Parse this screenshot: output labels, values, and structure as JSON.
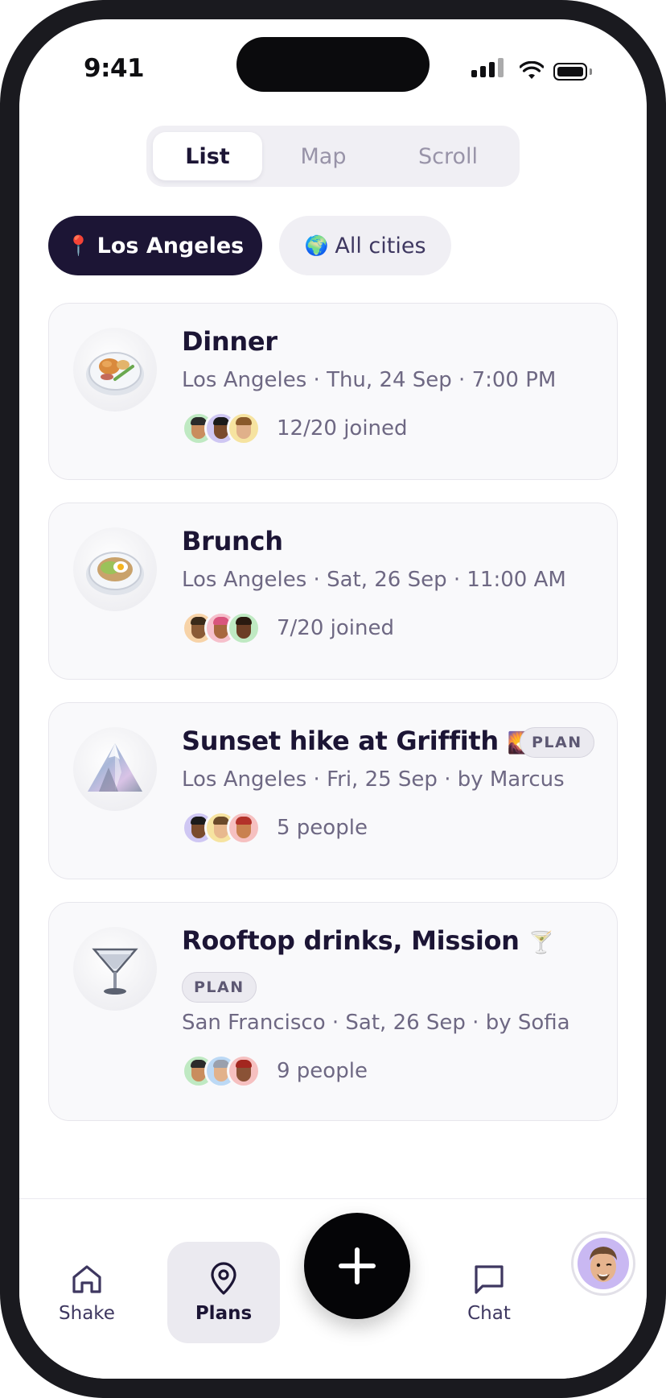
{
  "status_bar": {
    "time": "9:41"
  },
  "view_tabs": [
    {
      "label": "List",
      "active": true
    },
    {
      "label": "Map",
      "active": false
    },
    {
      "label": "Scroll",
      "active": false
    }
  ],
  "city_filters": [
    {
      "emoji": "📍",
      "label": "Los Angeles",
      "active": true
    },
    {
      "emoji": "🌍",
      "label": "All cities",
      "active": false
    }
  ],
  "events": [
    {
      "title": "Dinner",
      "title_emoji": "",
      "badge": "",
      "subtitle": "Los Angeles · Thu, 24 Sep · 7:00 PM",
      "attendance": "12/20 joined",
      "thumb_icon": "dinner-plate-icon"
    },
    {
      "title": "Brunch",
      "title_emoji": "",
      "badge": "",
      "subtitle": "Los Angeles · Sat, 26 Sep · 11:00 AM",
      "attendance": "7/20 joined",
      "thumb_icon": "brunch-plate-icon"
    },
    {
      "title": "Sunset hike at Griffith",
      "title_emoji": "🌄",
      "badge": "PLAN",
      "subtitle": "Los Angeles · Fri, 25 Sep · by Marcus",
      "attendance": "5 people",
      "thumb_icon": "mountain-icon"
    },
    {
      "title": "Rooftop drinks, Mission",
      "title_emoji": "🍸",
      "badge": "PLAN",
      "subtitle": "San Francisco · Sat, 26 Sep · by Sofia",
      "attendance": "9 people",
      "thumb_icon": "cocktail-glass-icon"
    }
  ],
  "bottom_nav": {
    "shake": "Shake",
    "plans": "Plans",
    "chat": "Chat",
    "active": "Plans"
  },
  "colors": {
    "primary": "#1c1535",
    "muted_text": "#6e6883",
    "chip_bg": "#f0eff4",
    "card_bg": "#f9f9fb",
    "fab": "#050507"
  }
}
